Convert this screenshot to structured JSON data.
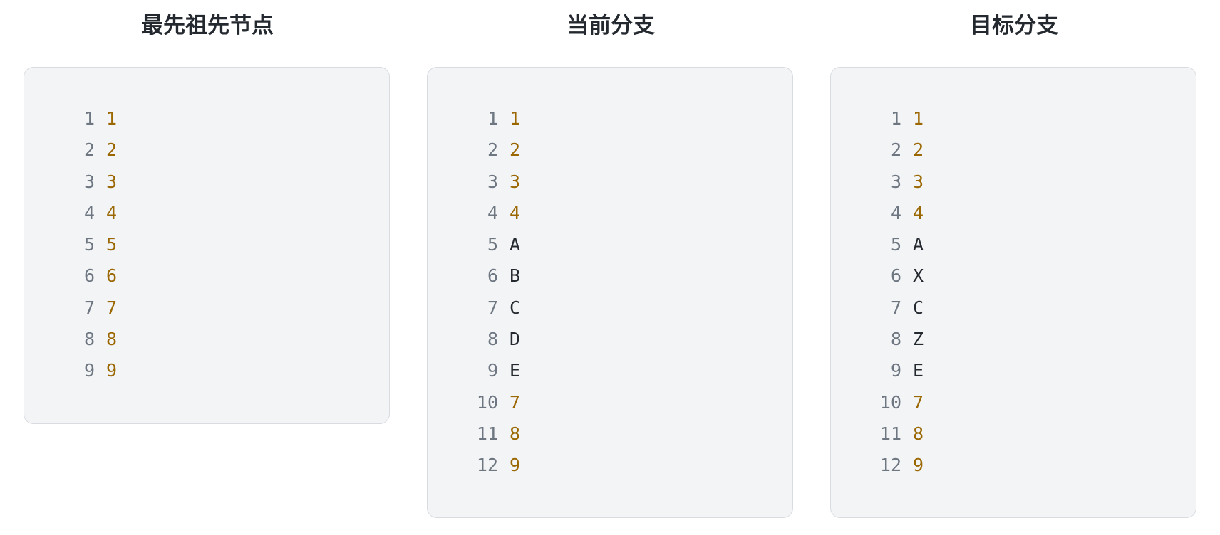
{
  "columns": [
    {
      "id": "base",
      "title": "最先祖先节点",
      "lines": [
        {
          "num": "1",
          "text": "1",
          "kind": "orig"
        },
        {
          "num": "2",
          "text": "2",
          "kind": "orig"
        },
        {
          "num": "3",
          "text": "3",
          "kind": "orig"
        },
        {
          "num": "4",
          "text": "4",
          "kind": "orig"
        },
        {
          "num": "5",
          "text": "5",
          "kind": "orig"
        },
        {
          "num": "6",
          "text": "6",
          "kind": "orig"
        },
        {
          "num": "7",
          "text": "7",
          "kind": "orig"
        },
        {
          "num": "8",
          "text": "8",
          "kind": "orig"
        },
        {
          "num": "9",
          "text": "9",
          "kind": "orig"
        }
      ]
    },
    {
      "id": "current",
      "title": "当前分支",
      "lines": [
        {
          "num": "1",
          "text": "1",
          "kind": "orig"
        },
        {
          "num": "2",
          "text": "2",
          "kind": "orig"
        },
        {
          "num": "3",
          "text": "3",
          "kind": "orig"
        },
        {
          "num": "4",
          "text": "4",
          "kind": "orig"
        },
        {
          "num": "5",
          "text": "A",
          "kind": "changed"
        },
        {
          "num": "6",
          "text": "B",
          "kind": "changed"
        },
        {
          "num": "7",
          "text": "C",
          "kind": "changed"
        },
        {
          "num": "8",
          "text": "D",
          "kind": "changed"
        },
        {
          "num": "9",
          "text": "E",
          "kind": "changed"
        },
        {
          "num": "10",
          "text": "7",
          "kind": "orig"
        },
        {
          "num": "11",
          "text": "8",
          "kind": "orig"
        },
        {
          "num": "12",
          "text": "9",
          "kind": "orig"
        }
      ]
    },
    {
      "id": "target",
      "title": "目标分支",
      "lines": [
        {
          "num": "1",
          "text": "1",
          "kind": "orig"
        },
        {
          "num": "2",
          "text": "2",
          "kind": "orig"
        },
        {
          "num": "3",
          "text": "3",
          "kind": "orig"
        },
        {
          "num": "4",
          "text": "4",
          "kind": "orig"
        },
        {
          "num": "5",
          "text": "A",
          "kind": "changed"
        },
        {
          "num": "6",
          "text": "X",
          "kind": "changed"
        },
        {
          "num": "7",
          "text": "C",
          "kind": "changed"
        },
        {
          "num": "8",
          "text": "Z",
          "kind": "changed"
        },
        {
          "num": "9",
          "text": "E",
          "kind": "changed"
        },
        {
          "num": "10",
          "text": "7",
          "kind": "orig"
        },
        {
          "num": "11",
          "text": "8",
          "kind": "orig"
        },
        {
          "num": "12",
          "text": "9",
          "kind": "orig"
        }
      ]
    }
  ],
  "colors": {
    "line_number": "#6e7781",
    "original_text": "#9a6700",
    "changed_text": "#24292f",
    "panel_bg": "#f3f4f6",
    "panel_border": "#d8dbdf"
  }
}
